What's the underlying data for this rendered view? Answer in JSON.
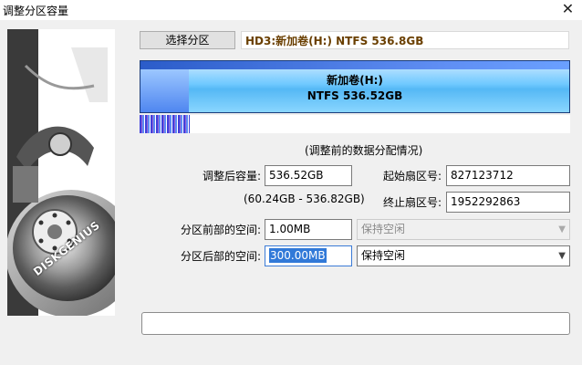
{
  "window": {
    "title": "调整分区容量",
    "close_glyph": "✕"
  },
  "toolbar": {
    "select_partition_label": "选择分区",
    "disk_info": "HD3:新加卷(H:) NTFS 536.8GB"
  },
  "partition_bar": {
    "name": "新加卷(H:)",
    "detail": "NTFS 536.52GB"
  },
  "note": "(调整前的数据分配情况)",
  "form": {
    "adjusted_capacity_label": "调整后容量:",
    "adjusted_capacity_value": "536.52GB",
    "capacity_range": "(60.24GB - 536.82GB)",
    "start_sector_label": "起始扇区号:",
    "start_sector_value": "827123712",
    "end_sector_label": "终止扇区号:",
    "end_sector_value": "1952292863",
    "before_space_label": "分区前部的空间:",
    "before_space_value": "1.00MB",
    "before_space_option": "保持空闲",
    "after_space_label": "分区后部的空间:",
    "after_space_value": "300.00MB",
    "after_space_option": "保持空闲"
  },
  "brand": {
    "logo_text": "DISKGENIUS"
  },
  "colors": {
    "partition_fill": "#55b8f5",
    "disk_info_text": "#6a3f00",
    "selection": "#3179d8"
  }
}
